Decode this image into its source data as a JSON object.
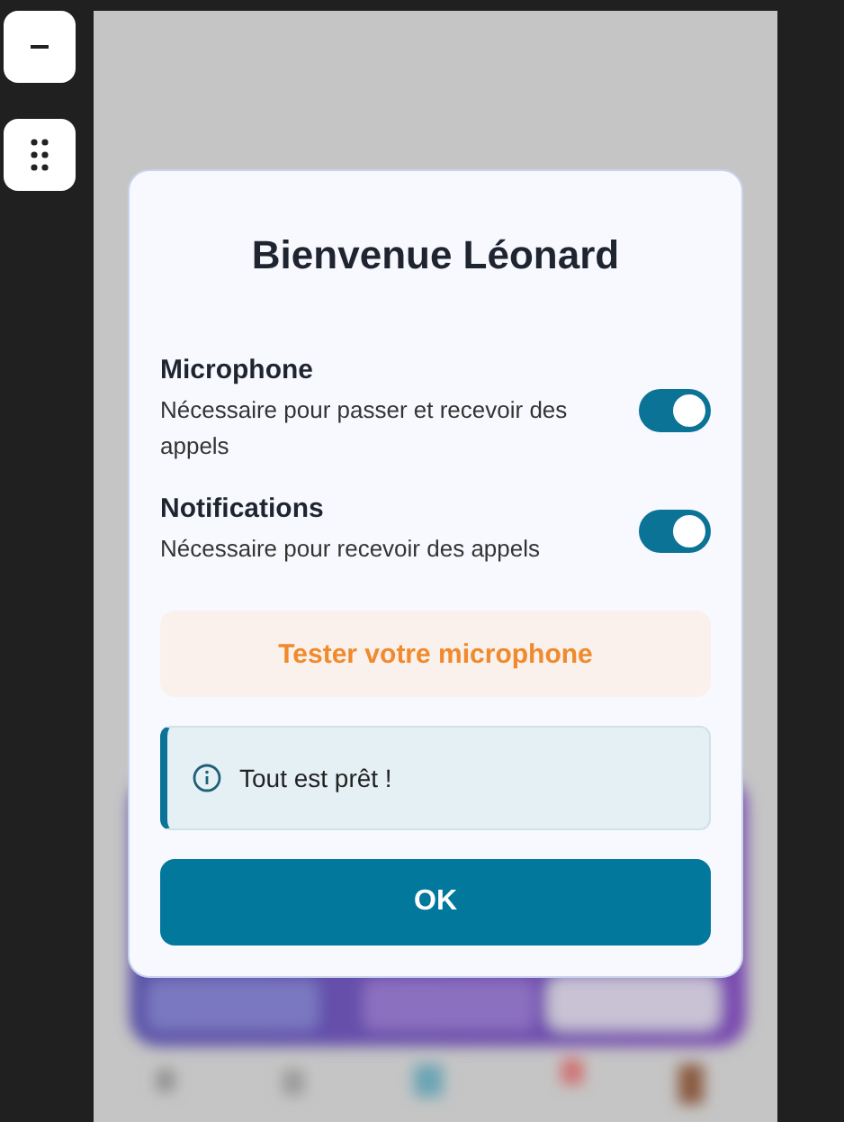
{
  "side_buttons": [
    {
      "kind": "minus"
    },
    {
      "kind": "grid"
    }
  ],
  "dialog": {
    "title": "Bienvenue Léonard",
    "permissions": [
      {
        "name": "Microphone",
        "description": "Nécessaire pour passer et recevoir des appels",
        "on": true
      },
      {
        "name": "Notifications",
        "description": "Nécessaire pour recevoir des appels",
        "on": true
      }
    ],
    "test_button": "Tester votre microphone",
    "notice": {
      "kind": "info",
      "text": "Tout est prêt !"
    },
    "ok_button": "OK"
  }
}
